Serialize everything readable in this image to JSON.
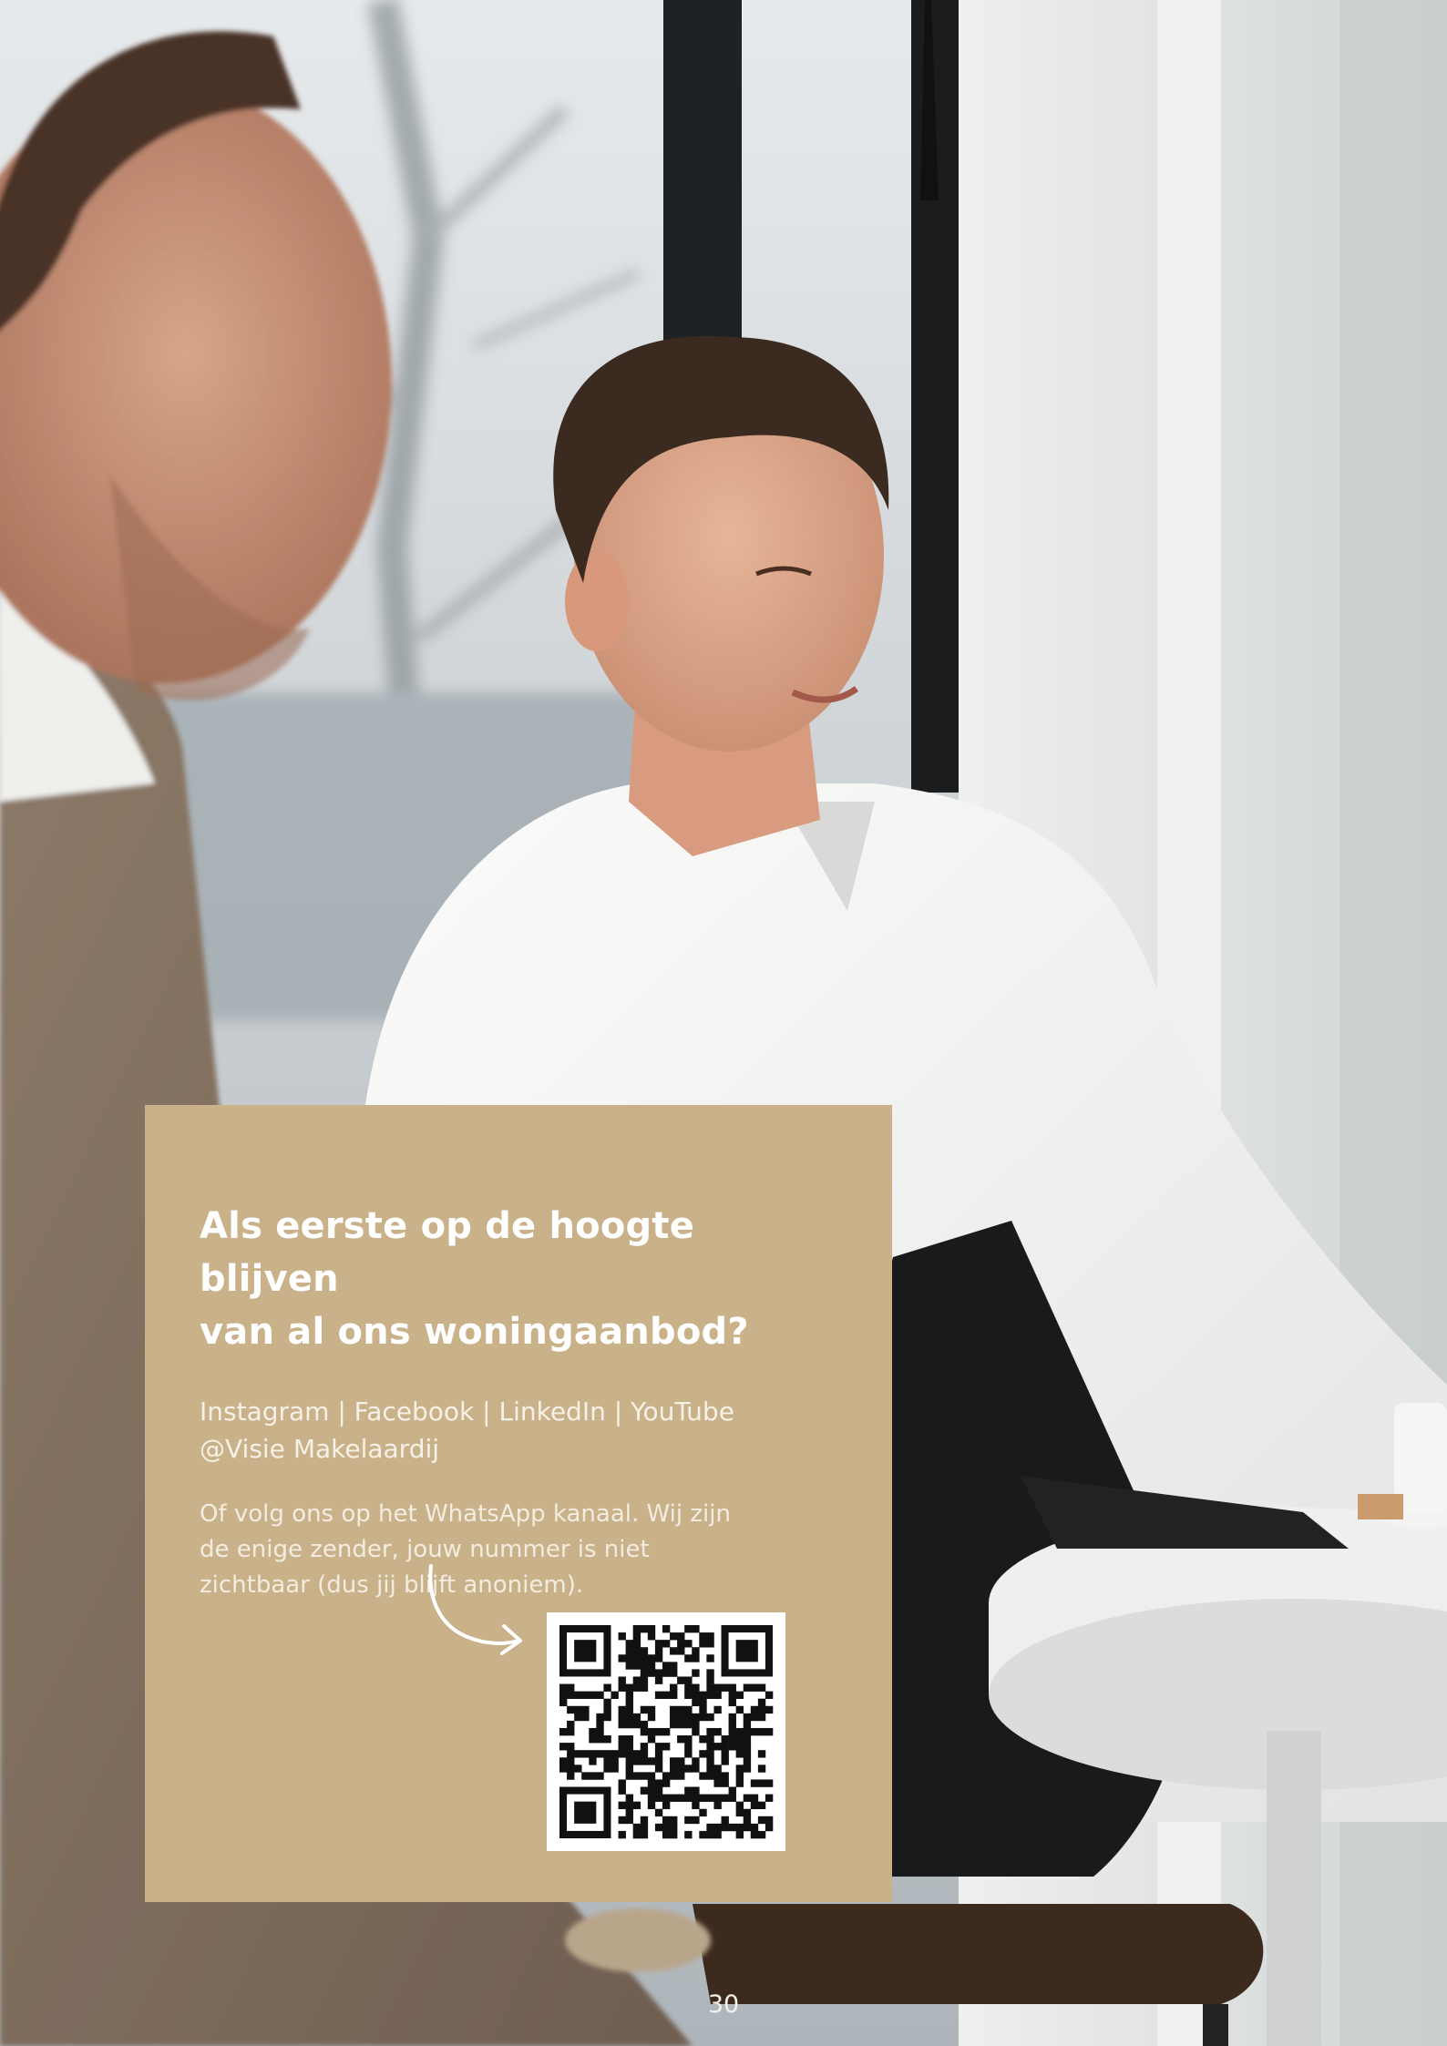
{
  "card": {
    "title_lines": [
      "Als eerste op de hoogte blijven",
      "van al ons woningaanbod?"
    ],
    "social_lines": [
      "Instagram | Facebook | LinkedIn | YouTube",
      "@Visie Makelaardij"
    ],
    "whatsapp_lines": [
      "Of volg ons op het WhatsApp kanaal. Wij zijn",
      "de enige zender, jouw nummer is niet",
      "zichtbaar (dus jij blijft anoniem)."
    ],
    "accent_color": "#c9b18a"
  },
  "icons": {
    "arrow": "curved-arrow-icon",
    "qr": "qr-code-icon"
  },
  "page_number": "30"
}
